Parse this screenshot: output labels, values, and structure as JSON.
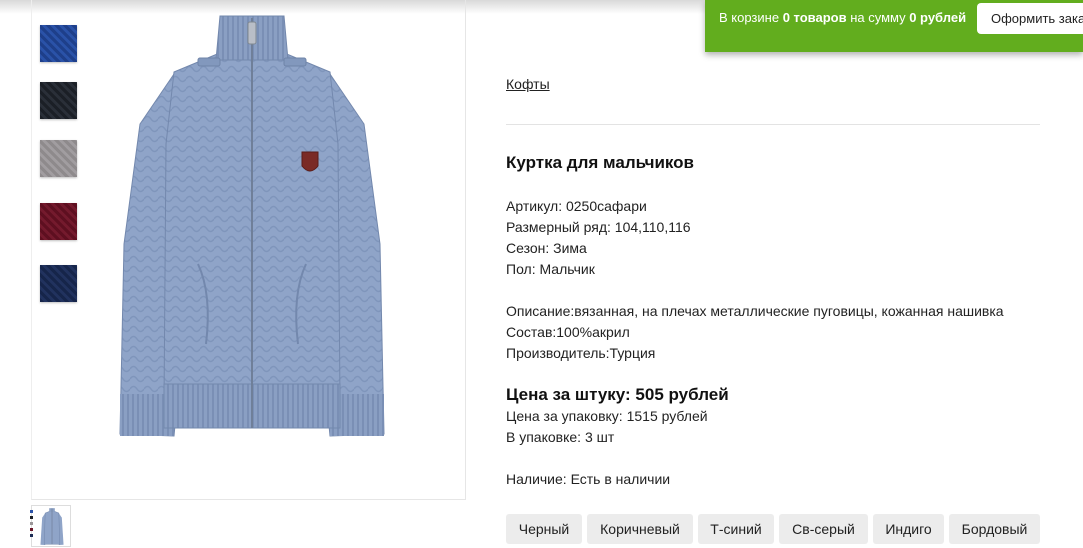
{
  "cart": {
    "prefix": "В корзине ",
    "items_count": "0 товаров",
    "middle": " на сумму ",
    "sum": "0 рублей",
    "checkout_label": "Оформить зака"
  },
  "breadcrumb": "Кофты",
  "product": {
    "title": "Куртка для мальчиков",
    "article": "Артикул: 0250сафари",
    "sizes": "Размерный ряд: 104,110,116",
    "season": "Сезон: Зима",
    "gender": "Пол: Мальчик",
    "description": "Описание:вязанная, на плечах металлические пуговицы, кожанная нашивка",
    "composition": "Состав:100%акрил",
    "manufacturer": "Производитель:Турция",
    "price_unit": "Цена за штуку: 505 рублей",
    "price_pack": "Цена за упаковку: 1515 рублей",
    "pack_qty": "В упаковке: 3 шт",
    "availability": "Наличие: Есть в наличии"
  },
  "colors": [
    "Черный",
    "Коричневый",
    "Т-синий",
    "Св-серый",
    "Индиго",
    "Бордовый"
  ],
  "swatch_colors": {
    "blue": "#2a52a8",
    "black": "#1b1f26",
    "grey": "#9a9698",
    "burgundy": "#6a1527",
    "navy": "#1c2c55"
  },
  "accent_green": "#62ad1e"
}
